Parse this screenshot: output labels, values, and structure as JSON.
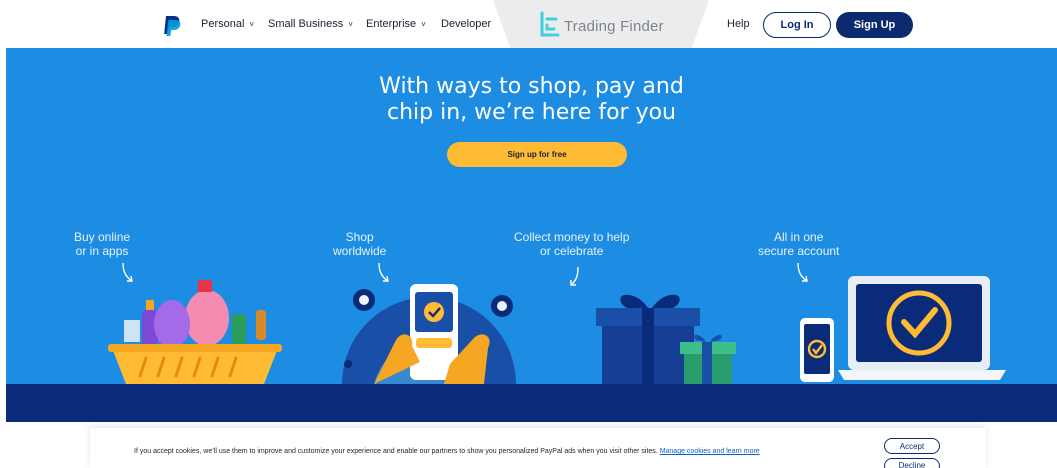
{
  "header": {
    "nav": [
      {
        "label": "Personal",
        "has_dropdown": true
      },
      {
        "label": "Small Business",
        "has_dropdown": true
      },
      {
        "label": "Enterprise",
        "has_dropdown": true
      },
      {
        "label": "Developer",
        "has_dropdown": false
      }
    ],
    "watermark": "Trading Finder",
    "help_label": "Help",
    "login_label": "Log In",
    "signup_label": "Sign Up",
    "chevron_glyph": "˅"
  },
  "hero": {
    "title_line1": "With ways to shop, pay and",
    "title_line2": "chip in, we’re here for you",
    "cta_label": "Sign up for free",
    "features": [
      {
        "line1": "Buy online",
        "line2": "or in apps",
        "illustration": "shopping-basket"
      },
      {
        "line1": "Shop",
        "line2": "worldwide",
        "illustration": "phone-globe"
      },
      {
        "line1": "Collect money to help",
        "line2": "or celebrate",
        "illustration": "gift-boxes"
      },
      {
        "line1": "All in one",
        "line2": "secure account",
        "illustration": "laptop-phone-check"
      }
    ]
  },
  "cookie": {
    "text": "If you accept cookies, we’ll use them to improve and customize your experience and enable our partners to show you personalized PayPal ads when you visit other sites.",
    "link_label": "Manage cookies and learn more",
    "accept_label": "Accept",
    "decline_label": "Decline"
  },
  "colors": {
    "hero_blue": "#1c8de2",
    "navy": "#0b2a6f",
    "band_navy": "#0a2a7a",
    "cta_yellow": "#ffbb33"
  },
  "icons": [
    "paypal-logo-icon",
    "trading-finder-logo-icon",
    "chevron-down-icon",
    "curved-arrow-icon"
  ]
}
